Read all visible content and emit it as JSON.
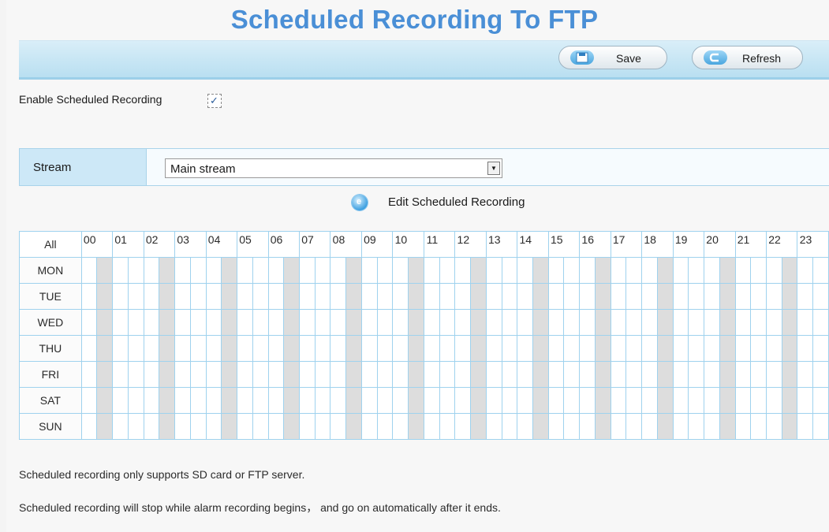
{
  "page": {
    "title": "Scheduled Recording To FTP"
  },
  "toolbar": {
    "save_label": "Save",
    "refresh_label": "Refresh",
    "save_icon": "disk-icon",
    "refresh_icon": "undo-arrow-icon"
  },
  "enable": {
    "label": "Enable Scheduled Recording",
    "checked": true
  },
  "stream": {
    "label": "Stream",
    "selected": "Main stream"
  },
  "edit_link": {
    "label": "Edit Scheduled Recording",
    "icon": "edit-circle-icon"
  },
  "schedule": {
    "all_label": "All",
    "hours": [
      "00",
      "01",
      "02",
      "03",
      "04",
      "05",
      "06",
      "07",
      "08",
      "09",
      "10",
      "11",
      "12",
      "13",
      "14",
      "15",
      "16",
      "17",
      "18",
      "19",
      "20",
      "21",
      "22",
      "23"
    ],
    "days": [
      "MON",
      "TUE",
      "WED",
      "THU",
      "FRI",
      "SAT",
      "SUN"
    ],
    "cell_colors": {
      "shaded": "#dddddd",
      "plain": "#ffffff",
      "grid": "#9fd2ee"
    }
  },
  "notes": {
    "sd_ftp": "Scheduled recording only supports SD card or FTP server.",
    "alarm": "Scheduled recording will stop while alarm recording begins， and go on automatically after it ends."
  },
  "colors": {
    "title": "#4a8fd6",
    "toolbar": "#b9dff1",
    "stream_label_bg": "#cde8f7"
  }
}
